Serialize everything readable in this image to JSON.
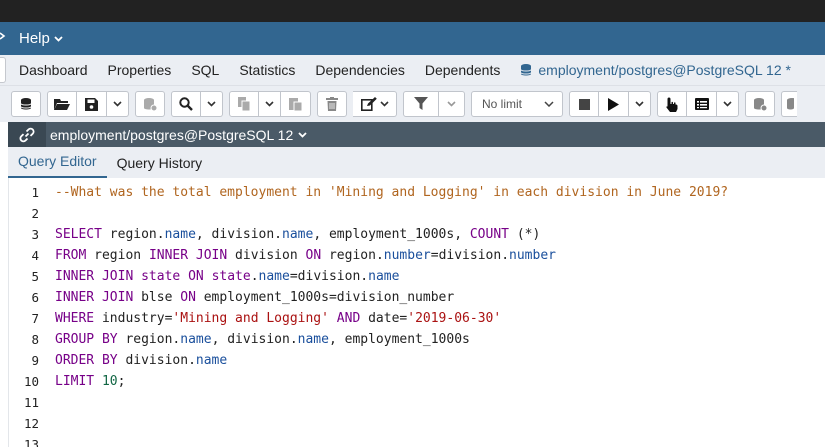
{
  "menubar": {
    "help_label": "Help"
  },
  "tabs": [
    {
      "label": "Dashboard"
    },
    {
      "label": "Properties"
    },
    {
      "label": "SQL"
    },
    {
      "label": "Statistics"
    },
    {
      "label": "Dependencies"
    },
    {
      "label": "Dependents"
    }
  ],
  "active_tab": {
    "label": "employment/postgres@PostgreSQL 12 *"
  },
  "toolbar": {
    "limit_label": "No limit"
  },
  "connection": {
    "label": "employment/postgres@PostgreSQL 12"
  },
  "subtabs": {
    "query_editor": "Query Editor",
    "query_history": "Query History"
  },
  "editor": {
    "line_numbers": [
      "1",
      "2",
      "3",
      "4",
      "5",
      "6",
      "7",
      "8",
      "9",
      "10",
      "11",
      "12",
      "13"
    ],
    "comment": "--What was the total employment in 'Mining and Logging' in each division in June 2019?",
    "l3": {
      "select": "SELECT",
      "t1": " region.",
      "p1": "name",
      "t2": ", division.",
      "p2": "name",
      "t3": ", employment_1000s, ",
      "count": "COUNT",
      "t4": " (*)"
    },
    "l4": {
      "from": "FROM",
      "t1": " region ",
      "inner": "INNER",
      "t2": " ",
      "join": "JOIN",
      "t3": " division ",
      "on": "ON",
      "t4": " region.",
      "p1": "number",
      "t5": "=division.",
      "p2": "number"
    },
    "l5": {
      "inner": "INNER",
      "t1": " ",
      "join": "JOIN",
      "t2": " ",
      "state1": "state",
      "t3": " ",
      "on": "ON",
      "t4": " ",
      "state2": "state",
      "t5": ".",
      "p1": "name",
      "t6": "=division.",
      "p2": "name"
    },
    "l6": {
      "inner": "INNER",
      "t1": " ",
      "join": "JOIN",
      "t2": " blse ",
      "on": "ON",
      "t3": " employment_1000s=division_number"
    },
    "l7": {
      "where": "WHERE",
      "t1": " industry=",
      "s1": "'Mining and Logging'",
      "t2": " ",
      "and": "AND",
      "t3": " date=",
      "s2": "'2019-06-30'"
    },
    "l8": {
      "group": "GROUP BY",
      "t1": " region.",
      "p1": "name",
      "t2": ", division.",
      "p2": "name",
      "t3": ", employment_1000s"
    },
    "l9": {
      "order": "ORDER BY",
      "t1": " division.",
      "p1": "name"
    },
    "l10": {
      "limit": "LIMIT",
      "t1": " ",
      "n": "10",
      "t2": ";"
    }
  }
}
